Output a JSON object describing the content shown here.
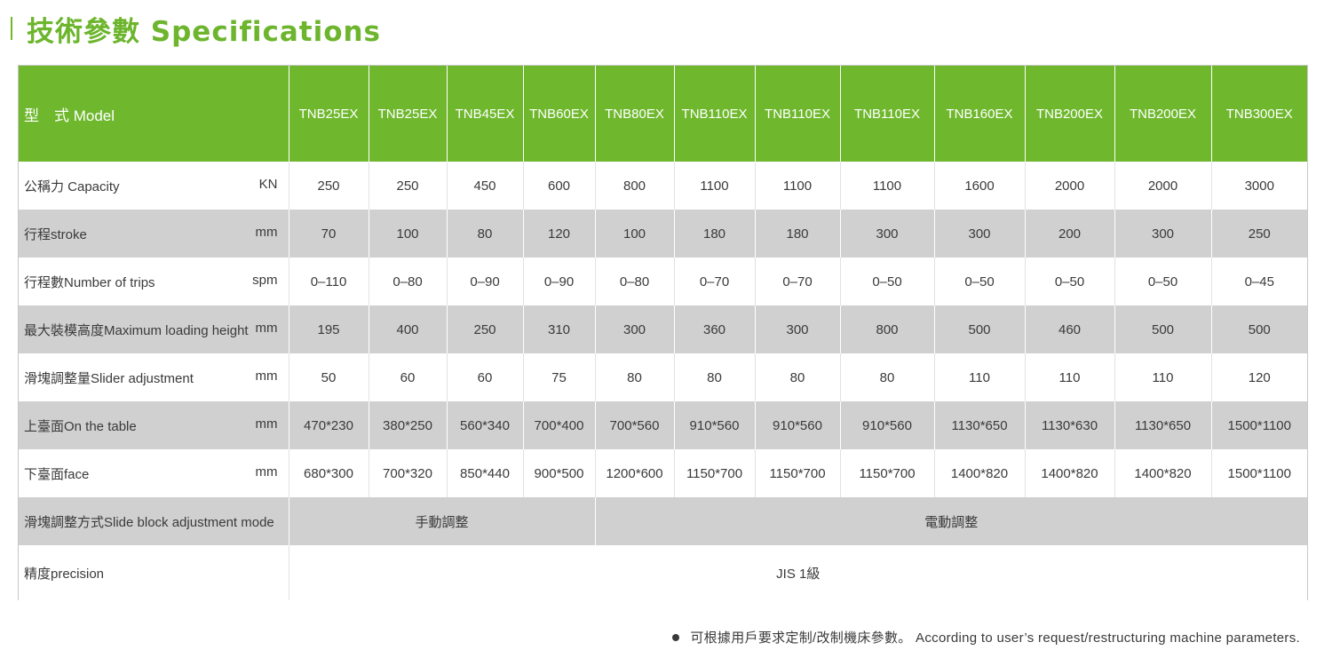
{
  "heading": {
    "title": "技術參數 Specifications"
  },
  "colors": {
    "accent": "#6fb82e",
    "row_gray": "#d0d0d0"
  },
  "table": {
    "model_label": "型　式 Model",
    "models": [
      "TNB25EX",
      "TNB25EX",
      "TNB45EX",
      "TNB60EX",
      "TNB80EX",
      "TNB110EX",
      "TNB110EX",
      "TNB110EX",
      "TNB160EX",
      "TNB200EX",
      "TNB200EX",
      "TNB300EX"
    ],
    "rows": [
      {
        "label": "公稱力  Capacity",
        "unit": "KN",
        "values": [
          "250",
          "250",
          "450",
          "600",
          "800",
          "1100",
          "1100",
          "1100",
          "1600",
          "2000",
          "2000",
          "3000"
        ]
      },
      {
        "label": "行程stroke",
        "unit": "mm",
        "values": [
          "70",
          "100",
          "80",
          "120",
          "100",
          "180",
          "180",
          "300",
          "300",
          "200",
          "300",
          "250"
        ]
      },
      {
        "label": "行程數Number of trips",
        "unit": "spm",
        "values": [
          "0–110",
          "0–80",
          "0–90",
          "0–90",
          "0–80",
          "0–70",
          "0–70",
          "0–50",
          "0–50",
          "0–50",
          "0–50",
          "0–45"
        ]
      },
      {
        "label": "最大裝模高度Maximum loading height",
        "unit": "mm",
        "values": [
          "195",
          "400",
          "250",
          "310",
          "300",
          "360",
          "300",
          "800",
          "500",
          "460",
          "500",
          "500"
        ]
      },
      {
        "label": "滑塊調整量Slider adjustment",
        "unit": "mm",
        "values": [
          "50",
          "60",
          "60",
          "75",
          "80",
          "80",
          "80",
          "80",
          "110",
          "110",
          "110",
          "120"
        ]
      },
      {
        "label": "上臺面On the table",
        "unit": "mm",
        "values": [
          "470*230",
          "380*250",
          "560*340",
          "700*400",
          "700*560",
          "910*560",
          "910*560",
          "910*560",
          "1130*650",
          "1130*630",
          "1130*650",
          "1500*1100"
        ]
      },
      {
        "label": "下臺面face",
        "unit": "mm",
        "values": [
          "680*300",
          "700*320",
          "850*440",
          "900*500",
          "1200*600",
          "1150*700",
          "1150*700",
          "1150*700",
          "1400*820",
          "1400*820",
          "1400*820",
          "1500*1100"
        ]
      }
    ],
    "adjust_mode": {
      "label": "滑塊調整方式Slide block adjustment mode",
      "manual": "手動調整",
      "electric": "電動調整"
    },
    "precision": {
      "label": "精度precision",
      "value": "JIS 1級"
    }
  },
  "footnote": "可根據用戶要求定制/改制機床參數。 According to user’s request/restructuring machine parameters."
}
